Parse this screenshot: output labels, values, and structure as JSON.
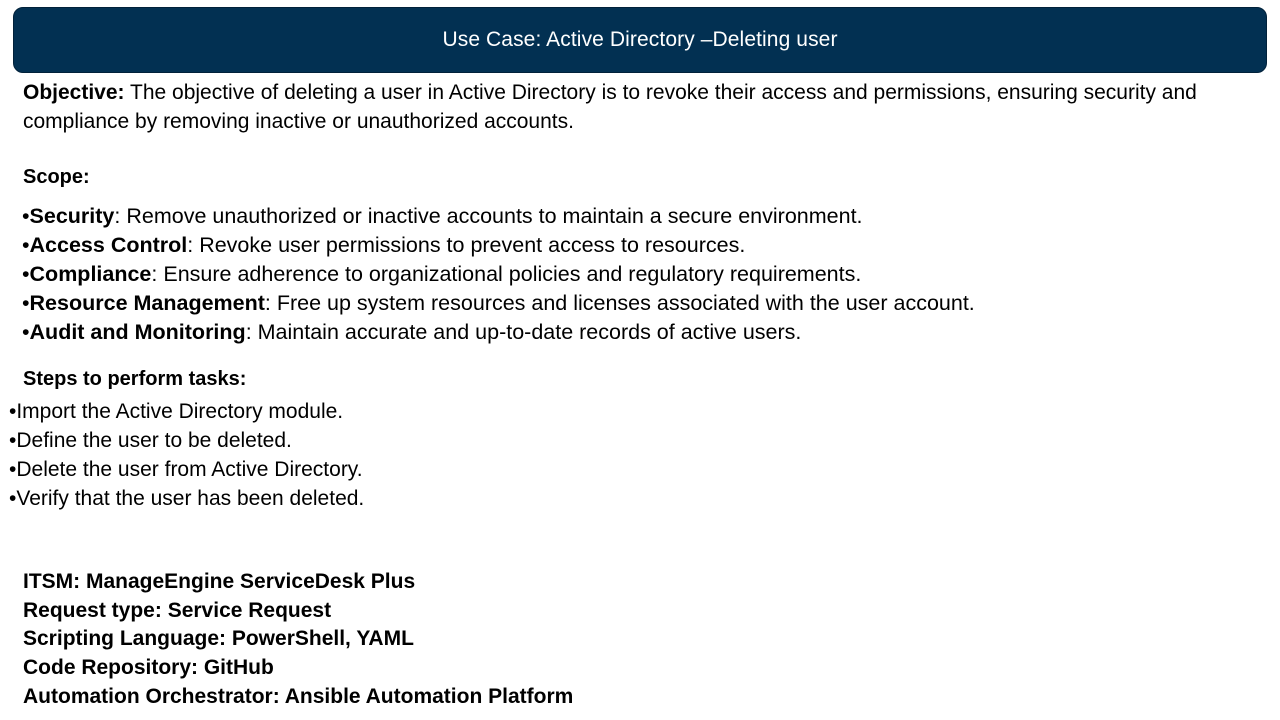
{
  "title": "Use Case: Active Directory –Deleting user",
  "objective": {
    "label": "Objective:",
    "text": " The objective of deleting a user in Active Directory is to revoke their access and permissions, ensuring security and compliance by removing inactive or unauthorized accounts."
  },
  "scope": {
    "heading": "Scope:",
    "bullet": "•",
    "items": [
      {
        "term": "Security",
        "desc": ": Remove unauthorized or inactive accounts to maintain a secure environment."
      },
      {
        "term": "Access Control",
        "desc": ": Revoke user permissions to prevent access to resources."
      },
      {
        "term": "Compliance",
        "desc": ": Ensure adherence to organizational policies and regulatory requirements."
      },
      {
        "term": "Resource Management",
        "desc": ": Free up system resources and licenses associated with the user account."
      },
      {
        "term": "Audit and Monitoring",
        "desc": ": Maintain accurate and up-to-date records of active users."
      }
    ]
  },
  "steps": {
    "heading": "Steps to perform tasks:",
    "items": [
      "•Import the Active Directory module.",
      "•Define the user to be deleted.",
      "•Delete the user from Active Directory.",
      "•Verify that the user has been deleted."
    ]
  },
  "info": [
    "ITSM: ManageEngine ServiceDesk Plus",
    "Request type: Service Request",
    "Scripting Language: PowerShell, YAML",
    "Code Repository: GitHub",
    "Automation Orchestrator: Ansible Automation Platform"
  ]
}
